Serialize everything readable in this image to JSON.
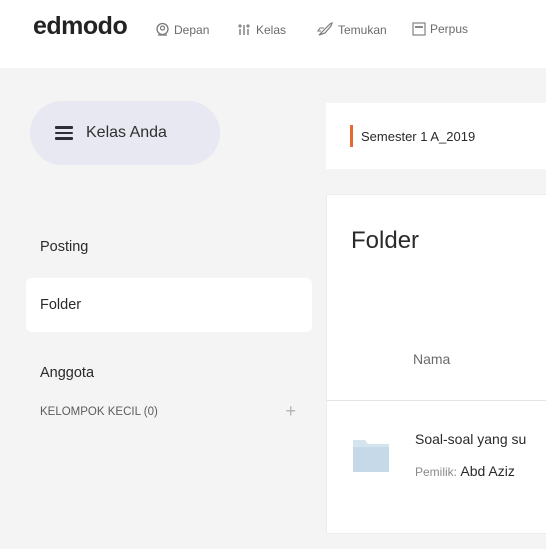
{
  "app": {
    "logo": "edmodo"
  },
  "nav": {
    "depan": "Depan",
    "kelas": "Kelas",
    "temukan": "Temukan",
    "perpus": "Perpus"
  },
  "sidebar": {
    "kelas_button": "Kelas Anda",
    "items": [
      {
        "label": "Posting"
      },
      {
        "label": "Folder",
        "active": true
      },
      {
        "label": "Anggota"
      }
    ],
    "kelompok_label": "KELOMPOK KECIL (0)",
    "add_symbol": "+"
  },
  "header": {
    "semester": "Semester 1 A_2019",
    "accent_color": "#e8692f"
  },
  "folder_panel": {
    "title": "Folder",
    "column_nama": "Nama",
    "rows": [
      {
        "name": "Soal-soal yang su",
        "owner_label": "Pemilik:",
        "owner": "Abd Aziz"
      }
    ]
  }
}
